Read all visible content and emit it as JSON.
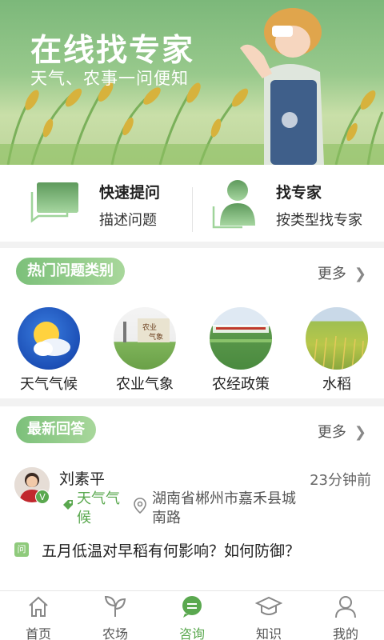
{
  "banner": {
    "title": "在线找专家",
    "subtitle": "天气、农事一问便知"
  },
  "quick_actions": [
    {
      "title": "快速提问",
      "desc": "描述问题",
      "icon": "chat-bubble-icon"
    },
    {
      "title": "找专家",
      "desc": "按类型找专家",
      "icon": "expert-person-icon"
    }
  ],
  "hot": {
    "title": "热门问题类别",
    "more": "更多",
    "categories": [
      {
        "label": "天气气候"
      },
      {
        "label": "农业气象"
      },
      {
        "label": "农经政策"
      },
      {
        "label": "水稻"
      }
    ]
  },
  "latest": {
    "title": "最新回答",
    "more": "更多",
    "item": {
      "user": "刘素平",
      "badge": "V",
      "time": "23分钟前",
      "tag": "天气气候",
      "location": "湖南省郴州市嘉禾县城南路",
      "question_badge": "问",
      "question": "五月低温对早稻有何影响？如何防御？"
    }
  },
  "nav": [
    {
      "label": "首页",
      "icon": "home-icon",
      "active": false
    },
    {
      "label": "农场",
      "icon": "leaf-icon",
      "active": false
    },
    {
      "label": "咨询",
      "icon": "chat-icon",
      "active": true
    },
    {
      "label": "知识",
      "icon": "graduation-cap-icon",
      "active": false
    },
    {
      "label": "我的",
      "icon": "user-icon",
      "active": false
    }
  ],
  "colors": {
    "accent": "#5aa84f",
    "banner_top": "#7cb87a",
    "background": "#f2f2f2"
  }
}
